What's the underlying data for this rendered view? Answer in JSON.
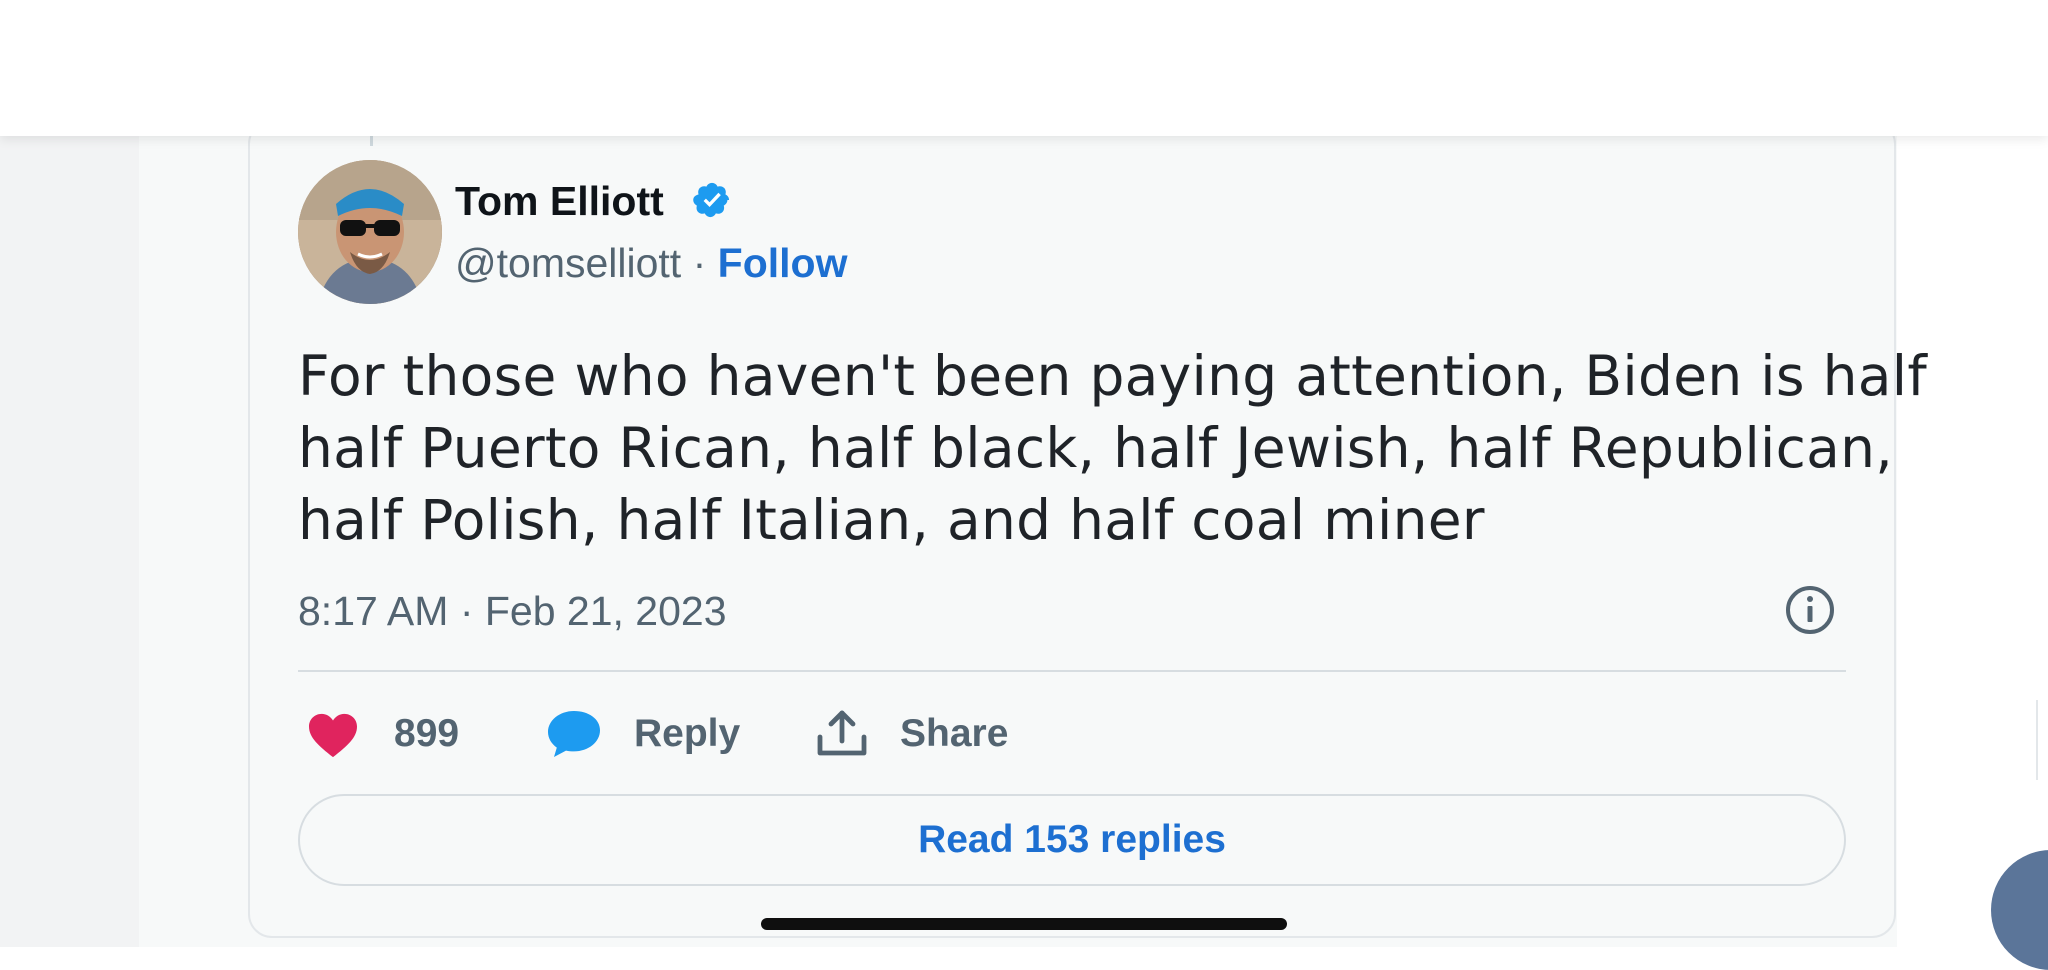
{
  "tweet": {
    "author": {
      "name": "Tom Elliott",
      "handle": "@tomselliott",
      "separator": "·",
      "follow_label": "Follow",
      "verified": true
    },
    "text_lines": [
      "For those who haven't been paying attention, Biden is half",
      "half Puerto Rican, half black, half Jewish, half Republican,",
      "half Polish, half Italian, and half coal miner"
    ],
    "timestamp": "8:17 AM · Feb 21, 2023",
    "actions": {
      "like_count": "899",
      "reply_label": "Reply",
      "share_label": "Share"
    },
    "read_replies_label": "Read 153 replies"
  },
  "colors": {
    "like": "#e0245e",
    "reply": "#1d9bf0",
    "link": "#1d6fd1",
    "verified": "#1d9bf0"
  },
  "icons": [
    "verified-badge-icon",
    "info-icon",
    "heart-icon",
    "speech-bubble-icon",
    "share-icon"
  ]
}
